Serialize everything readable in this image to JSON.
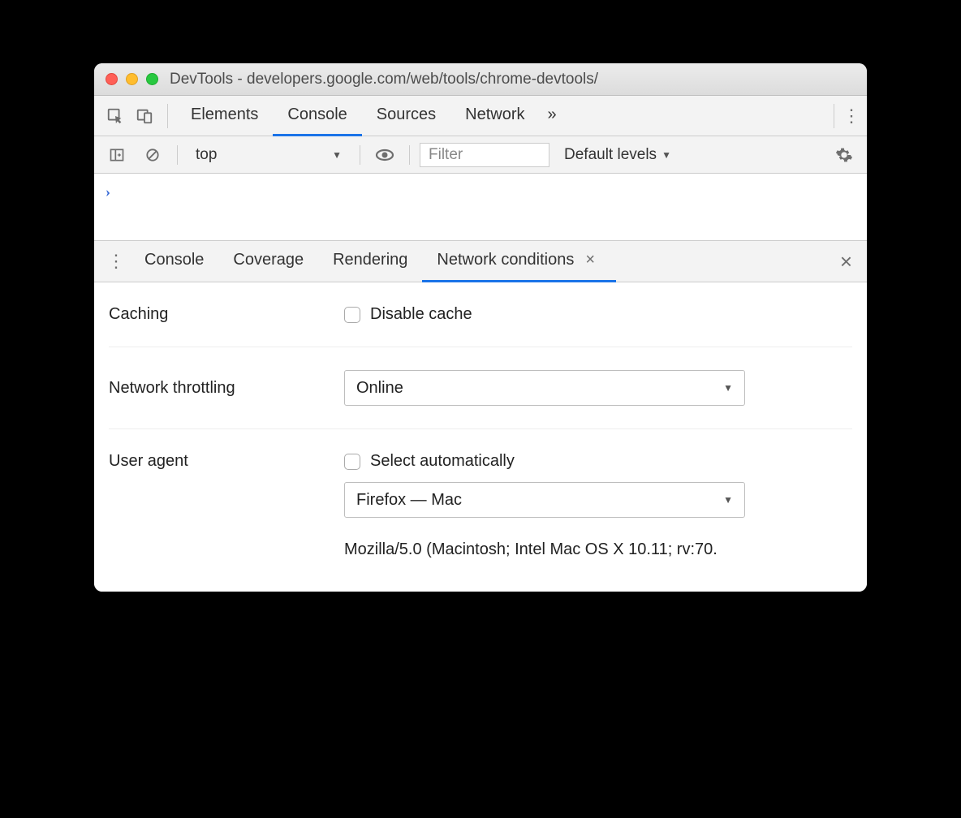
{
  "window": {
    "title": "DevTools - developers.google.com/web/tools/chrome-devtools/"
  },
  "tabs": {
    "elements": "Elements",
    "console": "Console",
    "sources": "Sources",
    "network": "Network",
    "more": "»"
  },
  "toolbar": {
    "context": "top",
    "filter_placeholder": "Filter",
    "levels": "Default levels"
  },
  "console": {
    "prompt": ">"
  },
  "drawer_tabs": {
    "console": "Console",
    "coverage": "Coverage",
    "rendering": "Rendering",
    "network_conditions": "Network conditions"
  },
  "panel": {
    "caching_label": "Caching",
    "disable_cache": "Disable cache",
    "throttling_label": "Network throttling",
    "throttling_value": "Online",
    "ua_label": "User agent",
    "ua_auto": "Select automatically",
    "ua_value": "Firefox — Mac",
    "ua_string": "Mozilla/5.0 (Macintosh; Intel Mac OS X 10.11; rv:70."
  }
}
